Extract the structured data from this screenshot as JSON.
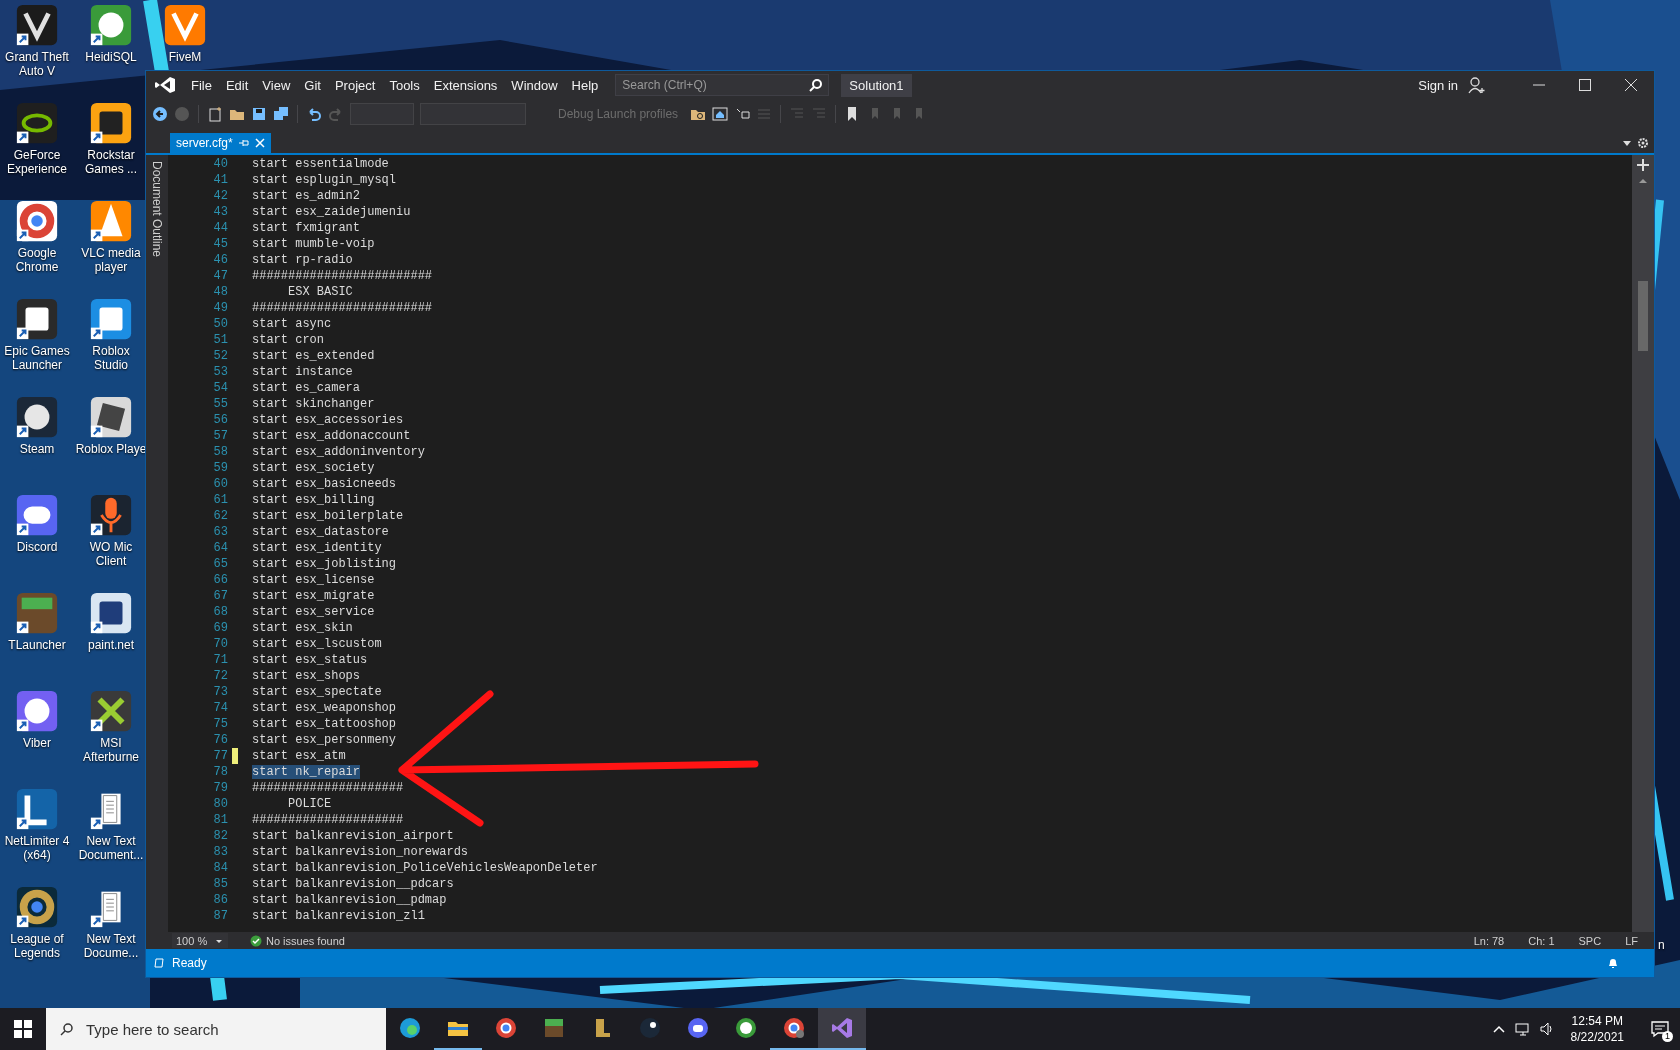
{
  "desktop": {
    "icons": [
      {
        "label": "Grand Theft Auto V"
      },
      {
        "label": "GeForce Experience"
      },
      {
        "label": "Google Chrome"
      },
      {
        "label": "Epic Games Launcher"
      },
      {
        "label": "Steam"
      },
      {
        "label": "Discord"
      },
      {
        "label": "TLauncher"
      },
      {
        "label": "Viber"
      },
      {
        "label": "NetLimiter 4 (x64)"
      },
      {
        "label": "League of Legends"
      },
      {
        "label": "HeidiSQL"
      },
      {
        "label": "Rockstar Games ..."
      },
      {
        "label": "VLC media player"
      },
      {
        "label": "Roblox Studio"
      },
      {
        "label": "Roblox Playe"
      },
      {
        "label": "WO Mic Client"
      },
      {
        "label": "paint.net"
      },
      {
        "label": "MSI Afterburne"
      },
      {
        "label": "New Text Document..."
      },
      {
        "label": "New Text Docume..."
      },
      {
        "label": "FiveM"
      }
    ],
    "edge_fragment": "n"
  },
  "window": {
    "menu": [
      "File",
      "Edit",
      "View",
      "Git",
      "Project",
      "Tools",
      "Extensions",
      "Window",
      "Help"
    ],
    "search": {
      "placeholder": "Search (Ctrl+Q)"
    },
    "solution": "Solution1",
    "sign_in": "Sign in"
  },
  "toolbar": {
    "launch_profiles": {
      "label": "Debug Launch profiles",
      "disabled": true
    }
  },
  "tabs": [
    {
      "label": "server.cfg*",
      "selected": true
    }
  ],
  "side_panel": {
    "label": "Document Outline"
  },
  "editor": {
    "lines": [
      {
        "number": "40",
        "text": "start essentialmode",
        "selected": false,
        "modified": false
      },
      {
        "number": "41",
        "text": "start esplugin_mysql",
        "selected": false,
        "modified": false
      },
      {
        "number": "42",
        "text": "start es_admin2",
        "selected": false,
        "modified": false
      },
      {
        "number": "43",
        "text": "start esx_zaidejumeniu",
        "selected": false,
        "modified": false
      },
      {
        "number": "44",
        "text": "start fxmigrant",
        "selected": false,
        "modified": false
      },
      {
        "number": "45",
        "text": "start mumble-voip",
        "selected": false,
        "modified": false
      },
      {
        "number": "46",
        "text": "start rp-radio",
        "selected": false,
        "modified": false
      },
      {
        "number": "47",
        "text": "#########################",
        "selected": false,
        "modified": false
      },
      {
        "number": "48",
        "text": "     ESX BASIC",
        "selected": false,
        "modified": false
      },
      {
        "number": "49",
        "text": "#########################",
        "selected": false,
        "modified": false
      },
      {
        "number": "50",
        "text": "start async",
        "selected": false,
        "modified": false
      },
      {
        "number": "51",
        "text": "start cron",
        "selected": false,
        "modified": false
      },
      {
        "number": "52",
        "text": "start es_extended",
        "selected": false,
        "modified": false
      },
      {
        "number": "53",
        "text": "start instance",
        "selected": false,
        "modified": false
      },
      {
        "number": "54",
        "text": "start es_camera",
        "selected": false,
        "modified": false
      },
      {
        "number": "55",
        "text": "start skinchanger",
        "selected": false,
        "modified": false
      },
      {
        "number": "56",
        "text": "start esx_accessories",
        "selected": false,
        "modified": false
      },
      {
        "number": "57",
        "text": "start esx_addonaccount",
        "selected": false,
        "modified": false
      },
      {
        "number": "58",
        "text": "start esx_addoninventory",
        "selected": false,
        "modified": false
      },
      {
        "number": "59",
        "text": "start esx_society",
        "selected": false,
        "modified": false
      },
      {
        "number": "60",
        "text": "start esx_basicneeds",
        "selected": false,
        "modified": false
      },
      {
        "number": "61",
        "text": "start esx_billing",
        "selected": false,
        "modified": false
      },
      {
        "number": "62",
        "text": "start esx_boilerplate",
        "selected": false,
        "modified": false
      },
      {
        "number": "63",
        "text": "start esx_datastore",
        "selected": false,
        "modified": false
      },
      {
        "number": "64",
        "text": "start esx_identity",
        "selected": false,
        "modified": false
      },
      {
        "number": "65",
        "text": "start esx_joblisting",
        "selected": false,
        "modified": false
      },
      {
        "number": "66",
        "text": "start esx_license",
        "selected": false,
        "modified": false
      },
      {
        "number": "67",
        "text": "start esx_migrate",
        "selected": false,
        "modified": false
      },
      {
        "number": "68",
        "text": "start esx_service",
        "selected": false,
        "modified": false
      },
      {
        "number": "69",
        "text": "start esx_skin",
        "selected": false,
        "modified": false
      },
      {
        "number": "70",
        "text": "start esx_lscustom",
        "selected": false,
        "modified": false
      },
      {
        "number": "71",
        "text": "start esx_status",
        "selected": false,
        "modified": false
      },
      {
        "number": "72",
        "text": "start esx_shops",
        "selected": false,
        "modified": false
      },
      {
        "number": "73",
        "text": "start esx_spectate",
        "selected": false,
        "modified": false
      },
      {
        "number": "74",
        "text": "start esx_weaponshop",
        "selected": false,
        "modified": false
      },
      {
        "number": "75",
        "text": "start esx_tattooshop",
        "selected": false,
        "modified": false
      },
      {
        "number": "76",
        "text": "start esx_personmeny",
        "selected": false,
        "modified": false
      },
      {
        "number": "77",
        "text": "start esx_atm",
        "selected": false,
        "modified": true
      },
      {
        "number": "78",
        "text": "start nk_repair",
        "selected": true,
        "modified": false
      },
      {
        "number": "79",
        "text": "#####################",
        "selected": false,
        "modified": false
      },
      {
        "number": "80",
        "text": "     POLICE",
        "selected": false,
        "modified": false
      },
      {
        "number": "81",
        "text": "#####################",
        "selected": false,
        "modified": false
      },
      {
        "number": "82",
        "text": "start balkanrevision_airport",
        "selected": false,
        "modified": false
      },
      {
        "number": "83",
        "text": "start balkanrevision_norewards",
        "selected": false,
        "modified": false
      },
      {
        "number": "84",
        "text": "start balkanrevision_PoliceVehiclesWeaponDeleter",
        "selected": false,
        "modified": false
      },
      {
        "number": "85",
        "text": "start balkanrevision__pdcars",
        "selected": false,
        "modified": false
      },
      {
        "number": "86",
        "text": "start balkanrevision__pdmap",
        "selected": false,
        "modified": false
      },
      {
        "number": "87",
        "text": "start balkanrevision_zl1",
        "selected": false,
        "modified": false
      }
    ]
  },
  "info_bar": {
    "zoom": "100 %",
    "issues": "No issues found",
    "line": "Ln: 78",
    "column": "Ch: 1",
    "indent": "SPC",
    "line_ending": "LF"
  },
  "status_bar": {
    "text": "Ready"
  },
  "taskbar": {
    "search": {
      "placeholder": "Type here to search"
    },
    "apps": [
      {
        "running": false,
        "active": false
      },
      {
        "running": true,
        "active": false
      },
      {
        "running": false,
        "active": false
      },
      {
        "running": false,
        "active": false
      },
      {
        "running": false,
        "active": false
      },
      {
        "running": false,
        "active": false
      },
      {
        "running": false,
        "active": false
      },
      {
        "running": false,
        "active": false
      },
      {
        "running": true,
        "active": false
      },
      {
        "running": true,
        "active": true
      }
    ],
    "time": "12:54 PM",
    "date": "8/22/2021",
    "notifications": "1"
  }
}
